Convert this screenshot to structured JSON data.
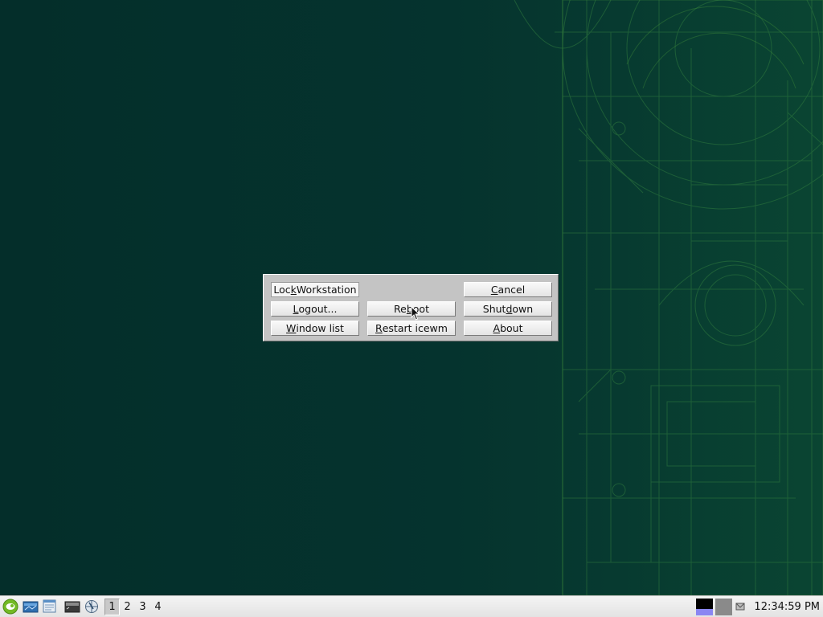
{
  "dialog": {
    "buttons": {
      "lock": {
        "pre": "Loc",
        "key": "k",
        "post": " Workstation"
      },
      "cancel": {
        "pre": "",
        "key": "C",
        "post": "ancel"
      },
      "logout": {
        "pre": "",
        "key": "L",
        "post": "ogout..."
      },
      "reboot": {
        "pre": "Re",
        "key": "b",
        "post": "oot"
      },
      "shutdown": {
        "pre": "Shut",
        "key": "d",
        "post": "own"
      },
      "window_list": {
        "pre": "",
        "key": "W",
        "post": "indow list"
      },
      "restart": {
        "pre": "",
        "key": "R",
        "post": "estart icewm"
      },
      "about": {
        "pre": "",
        "key": "A",
        "post": "bout"
      }
    }
  },
  "taskbar": {
    "start_menu_icon": "opensuse-logo-icon",
    "launchers": [
      "file-manager-icon",
      "window-list-icon",
      "terminal-icon",
      "web-browser-icon"
    ],
    "workspaces": [
      {
        "label": "1",
        "active": true
      },
      {
        "label": "2",
        "active": false
      },
      {
        "label": "3",
        "active": false
      },
      {
        "label": "4",
        "active": false
      }
    ],
    "tray": [
      "cpu-monitor-icon",
      "memory-monitor-icon",
      "mail-icon"
    ],
    "clock": "12:34:59 PM"
  },
  "colors": {
    "desktop_bg": "#05332e",
    "dialog_bg": "#c4c4c4",
    "taskbar_bg": "#eeeeee",
    "accent_green": "#73ba25"
  }
}
